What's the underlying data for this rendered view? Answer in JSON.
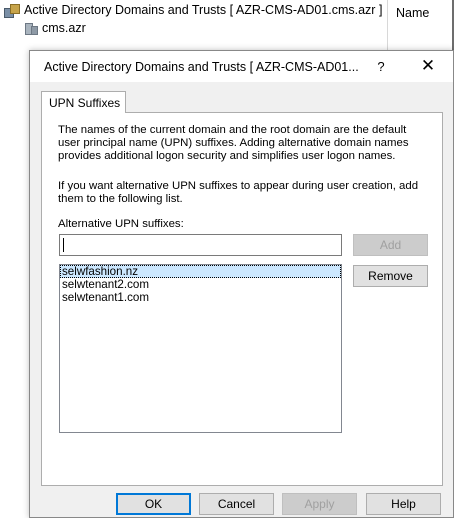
{
  "background_window": {
    "tree_root_label": "Active Directory Domains and Trusts [ AZR-CMS-AD01.cms.azr ]",
    "tree_child_label": "cms.azr",
    "column_header": "Name"
  },
  "dialog": {
    "title": "Active Directory Domains and Trusts [ AZR-CMS-AD01...",
    "help_glyph": "?",
    "close_glyph": "✕",
    "tabs": [
      {
        "label": "UPN Suffixes",
        "active": true
      }
    ],
    "description_1": "The names of the current domain and the root domain are the default user principal name (UPN) suffixes. Adding alternative domain names provides additional logon security and simplifies user logon names.",
    "description_2": "If you want alternative UPN suffixes to appear during user creation, add them to the following list.",
    "alt_suffix_label": "Alternative UPN suffixes:",
    "input_value": "",
    "add_label": "Add",
    "remove_label": "Remove",
    "suffixes": [
      "selwfashion.nz",
      "selwtenant2.com",
      "selwtenant1.com"
    ],
    "selected_index": 0,
    "footer": {
      "ok_label": "OK",
      "cancel_label": "Cancel",
      "apply_label": "Apply",
      "help_label": "Help"
    }
  },
  "colors": {
    "selection": "#cce8ff",
    "focus_border": "#0078d7",
    "dialog_bg": "#f0f0f0"
  }
}
